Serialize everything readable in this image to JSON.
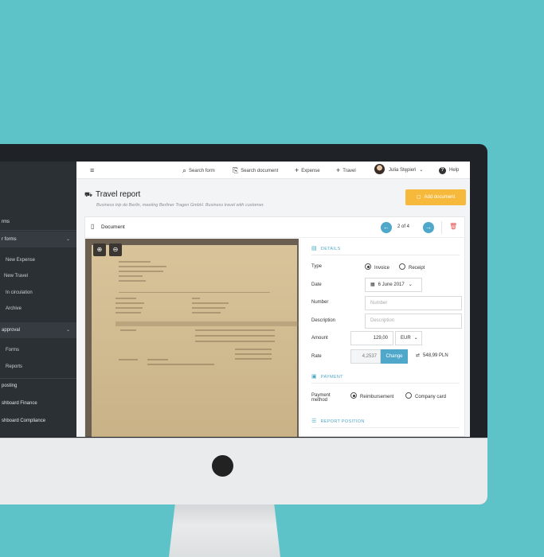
{
  "sidebar": {
    "items": [
      {
        "label": "rms"
      },
      {
        "label": "r forms"
      },
      {
        "label": "New Expense"
      },
      {
        "label": "New Travel"
      },
      {
        "label": "In circulation"
      },
      {
        "label": "Archive"
      },
      {
        "label": "approval"
      },
      {
        "label": "Forms"
      },
      {
        "label": "Reports"
      },
      {
        "label": "posting"
      },
      {
        "label": "shboard Finance"
      },
      {
        "label": "shboard Compliance"
      }
    ],
    "chevron": "⌄"
  },
  "topbar": {
    "search_form": "Search form",
    "search_document": "Search document",
    "expense": "Expense",
    "travel": "Travel",
    "user": "Julia Stępień",
    "help": "Help"
  },
  "page": {
    "title": "Travel report",
    "subtitle": "Business trip do Berlin, meeting Berliner Tragen GmbH. Business travel with customer.",
    "add_document": "Add document"
  },
  "document": {
    "title": "Document",
    "pager": "2 of 4"
  },
  "details": {
    "heading": "DETAILS",
    "type_label": "Type",
    "type_options": [
      "Invoice",
      "Receipt"
    ],
    "date_label": "Date",
    "date_value": "6 June 2017",
    "number_label": "Number",
    "number_placeholder": "Number",
    "description_label": "Description",
    "description_placeholder": "Description",
    "amount_label": "Amount",
    "amount_value": "129,00",
    "currency": "EUR",
    "rate_label": "Rate",
    "rate_value": "4,2537",
    "change_button": "Change",
    "converted": "548,99 PLN"
  },
  "payment": {
    "heading": "PAYMENT",
    "method_label_1": "Payment",
    "method_label_2": "method",
    "options": [
      "Reimbursement",
      "Company card"
    ]
  },
  "report_position": {
    "heading": "REPORT POSITION"
  },
  "colors": {
    "background": "#5ec3c9",
    "accent": "#4fa8c9",
    "add_button": "#f6b93b",
    "danger": "#e25050"
  }
}
